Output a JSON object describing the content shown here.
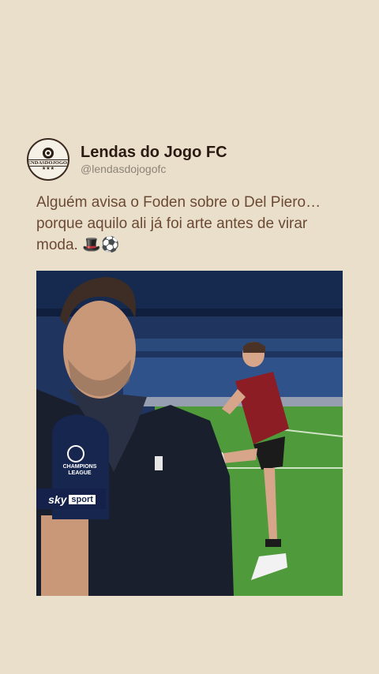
{
  "account": {
    "name": "Lendas do Jogo FC",
    "handle": "@lendasdojogofc",
    "avatar_text": "LENDASDOJOGO.fc"
  },
  "post": {
    "text": "Alguém avisa o Foden sobre o Del Piero… porque aquilo ali já foi arte antes de virar moda. 🎩⚽"
  },
  "video": {
    "mic_league_label": "CHAMPIONS LEAGUE",
    "mic_brand_sky": "sky",
    "mic_brand_sport": "sport"
  },
  "colors": {
    "background": "#eadfcb",
    "name_text": "#2b1a12",
    "body_text": "#6b4a35",
    "handle_text": "#8c8478",
    "pitch": "#4f9a3a",
    "stands": "#1f3560"
  }
}
